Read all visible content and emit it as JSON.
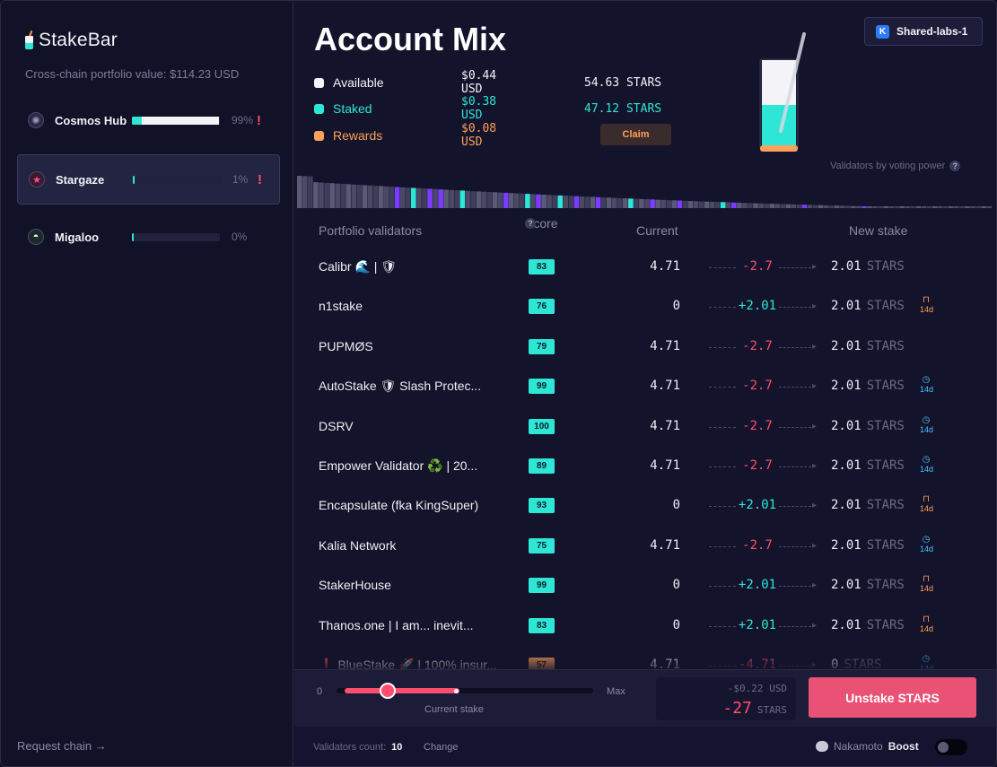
{
  "brand": {
    "name": "StakeBar"
  },
  "portfolio_label": "Cross-chain portfolio value: $114.23 USD",
  "chains": [
    {
      "name": "Cosmos Hub",
      "pct": "99%",
      "warn": "!",
      "fill": 0.99,
      "staked": 0.11,
      "icon": "cosmos-icon",
      "active": false
    },
    {
      "name": "Stargaze",
      "pct": "1%",
      "warn": "!",
      "fill": 0.01,
      "staked": 0.01,
      "icon": "stargaze-icon",
      "active": true
    },
    {
      "name": "Migaloo",
      "pct": "0%",
      "warn": "",
      "fill": 0.0,
      "staked": 0.0,
      "icon": "migaloo-icon",
      "active": false
    }
  ],
  "request_chain": "Request chain →",
  "title": "Account Mix",
  "account": {
    "label": "Shared-labs-1",
    "icon_letter": "K"
  },
  "legend": [
    {
      "label": "Available",
      "usd": "$0.44 USD",
      "stars": "54.63 STARS",
      "color": "#f4f4f8"
    },
    {
      "label": "Staked",
      "usd": "$0.38 USD",
      "stars": "47.12 STARS",
      "color": "#2ee6d6"
    },
    {
      "label": "Rewards",
      "usd": "$0.08 USD",
      "stars": "",
      "color": "#ffa05a"
    }
  ],
  "claim_label": "Claim",
  "voting_power_label": "Validators by voting power",
  "table": {
    "headers": {
      "validators": "Portfolio validators",
      "score": "Score",
      "current": "Current",
      "new_stake": "New stake"
    },
    "rows": [
      {
        "name": "Calibr 🌊 | 🛡",
        "score": "83",
        "current": "4.71",
        "delta": "-2.7",
        "dir": "neg",
        "new": "2.01",
        "unit": "STARS",
        "badge": "",
        "badge_label": ""
      },
      {
        "name": "n1stake",
        "score": "76",
        "current": "0",
        "delta": "+2.01",
        "dir": "pos",
        "new": "2.01",
        "unit": "STARS",
        "badge": "lock",
        "badge_label": "14d"
      },
      {
        "name": "PUPMØS",
        "score": "79",
        "current": "4.71",
        "delta": "-2.7",
        "dir": "neg",
        "new": "2.01",
        "unit": "STARS",
        "badge": "",
        "badge_label": ""
      },
      {
        "name": "AutoStake 🛡 Slash Protec...",
        "score": "99",
        "current": "4.71",
        "delta": "-2.7",
        "dir": "neg",
        "new": "2.01",
        "unit": "STARS",
        "badge": "clock",
        "badge_label": "14d"
      },
      {
        "name": "DSRV",
        "score": "100",
        "current": "4.71",
        "delta": "-2.7",
        "dir": "neg",
        "new": "2.01",
        "unit": "STARS",
        "badge": "clock",
        "badge_label": "14d"
      },
      {
        "name": "Empower Validator ♻️ | 20...",
        "score": "89",
        "current": "4.71",
        "delta": "-2.7",
        "dir": "neg",
        "new": "2.01",
        "unit": "STARS",
        "badge": "clock",
        "badge_label": "14d"
      },
      {
        "name": "Encapsulate (fka KingSuper)",
        "score": "93",
        "current": "0",
        "delta": "+2.01",
        "dir": "pos",
        "new": "2.01",
        "unit": "STARS",
        "badge": "lock",
        "badge_label": "14d"
      },
      {
        "name": "Kalia Network",
        "score": "75",
        "current": "4.71",
        "delta": "-2.7",
        "dir": "neg",
        "new": "2.01",
        "unit": "STARS",
        "badge": "clock",
        "badge_label": "14d"
      },
      {
        "name": "StakerHouse",
        "score": "99",
        "current": "0",
        "delta": "+2.01",
        "dir": "pos",
        "new": "2.01",
        "unit": "STARS",
        "badge": "lock",
        "badge_label": "14d"
      },
      {
        "name": "Thanos.one | I am... inevit...",
        "score": "83",
        "current": "0",
        "delta": "+2.01",
        "dir": "pos",
        "new": "2.01",
        "unit": "STARS",
        "badge": "lock",
        "badge_label": "14d"
      },
      {
        "name": "❗ BlueStake 🚀 | 100% insur...",
        "score": "57",
        "current": "4.71",
        "delta": "-4.71",
        "dir": "neg",
        "new": "0",
        "unit": "STARS",
        "badge": "clock",
        "badge_label": "14d",
        "low": true
      }
    ]
  },
  "slider": {
    "min": "0",
    "max": "Max",
    "caption": "Current stake"
  },
  "summary": {
    "usd": "-$0.22 USD",
    "amount": "-27",
    "unit": "STARS"
  },
  "unstake_label": "Unstake STARS",
  "footer": {
    "validators_count_label": "Validators count:",
    "validators_count": "10",
    "change": "Change",
    "nakamoto": "Nakamoto",
    "boost": "Boost"
  },
  "colors": {
    "accent_cyan": "#2ee6d6",
    "accent_red": "#ff4d6d",
    "accent_orange": "#ffa05a",
    "purple": "#7b3cff"
  }
}
